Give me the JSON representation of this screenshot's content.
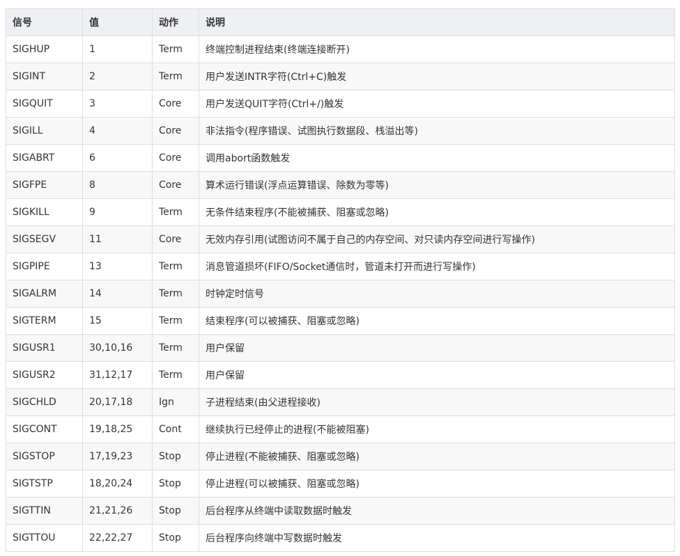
{
  "table": {
    "headers": [
      "信号",
      "值",
      "动作",
      "说明"
    ],
    "rows": [
      [
        "SIGHUP",
        "1",
        "Term",
        "终端控制进程结束(终端连接断开)"
      ],
      [
        "SIGINT",
        "2",
        "Term",
        "用户发送INTR字符(Ctrl+C)触发"
      ],
      [
        "SIGQUIT",
        "3",
        "Core",
        "用户发送QUIT字符(Ctrl+/)触发"
      ],
      [
        "SIGILL",
        "4",
        "Core",
        "非法指令(程序错误、试图执行数据段、栈溢出等)"
      ],
      [
        "SIGABRT",
        "6",
        "Core",
        "调用abort函数触发"
      ],
      [
        "SIGFPE",
        "8",
        "Core",
        "算术运行错误(浮点运算错误、除数为零等)"
      ],
      [
        "SIGKILL",
        "9",
        "Term",
        "无条件结束程序(不能被捕获、阻塞或忽略)"
      ],
      [
        "SIGSEGV",
        "11",
        "Core",
        "无效内存引用(试图访问不属于自己的内存空间、对只读内存空间进行写操作)"
      ],
      [
        "SIGPIPE",
        "13",
        "Term",
        "消息管道损坏(FIFO/Socket通信时，管道未打开而进行写操作)"
      ],
      [
        "SIGALRM",
        "14",
        "Term",
        "时钟定时信号"
      ],
      [
        "SIGTERM",
        "15",
        "Term",
        "结束程序(可以被捕获、阻塞或忽略)"
      ],
      [
        "SIGUSR1",
        "30,10,16",
        "Term",
        "用户保留"
      ],
      [
        "SIGUSR2",
        "31,12,17",
        "Term",
        "用户保留"
      ],
      [
        "SIGCHLD",
        "20,17,18",
        "Ign",
        "子进程结束(由父进程接收)"
      ],
      [
        "SIGCONT",
        "19,18,25",
        "Cont",
        "继续执行已经停止的进程(不能被阻塞)"
      ],
      [
        "SIGSTOP",
        "17,19,23",
        "Stop",
        "停止进程(不能被捕获、阻塞或忽略)"
      ],
      [
        "SIGTSTP",
        "18,20,24",
        "Stop",
        "停止进程(可以被捕获、阻塞或忽略)"
      ],
      [
        "SIGTTIN",
        "21,21,26",
        "Stop",
        "后台程序从终端中读取数据时触发"
      ],
      [
        "SIGTTOU",
        "22,22,27",
        "Stop",
        "后台程序向终端中写数据时触发"
      ]
    ]
  }
}
